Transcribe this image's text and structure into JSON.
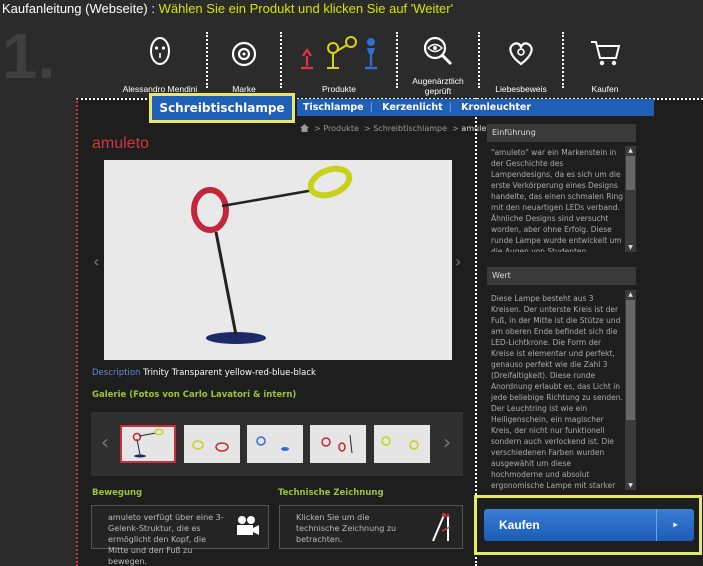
{
  "instruction": {
    "prefix": "Kaufanleitung (Webseite) : ",
    "highlight": "Wählen Sie ein Produkt und klicken Sie auf 'Weiter'"
  },
  "step_number": "1.",
  "top_nav": [
    {
      "label": "Alessandro Mendini",
      "icon": "face-mask-icon"
    },
    {
      "label": "Marke",
      "icon": "eye-target-icon"
    },
    {
      "label": "Produkte",
      "icon": "lamps-icon"
    },
    {
      "label": "Augenärztlich geprüft",
      "icon": "magnifier-eye-icon"
    },
    {
      "label": "Liebesbeweis",
      "icon": "heart-icon"
    },
    {
      "label": "Kaufen",
      "icon": "cart-icon"
    }
  ],
  "sub_nav": {
    "active": "Schreibtischlampe",
    "items": [
      "Tischlampe",
      "Kerzenlicht",
      "Kronleuchter"
    ]
  },
  "breadcrumb": {
    "items": [
      "Produkte",
      "Schreibtischlampe"
    ],
    "current": "amuleto"
  },
  "product": {
    "title": "amuleto",
    "description_key": "Description",
    "description_value": "Trinity Transparent yellow-red-blue-black"
  },
  "gallery": {
    "title": "Galerie (Fotos von Carlo Lavatori & intern)",
    "thumb_count": 5
  },
  "movement": {
    "title": "Bewegung",
    "text": "amuleto verfügt über eine 3-Gelenk-Struktur, die es ermöglicht den Kopf, die Mitte und den Fuß zu bewegen."
  },
  "technical": {
    "title": "Technische Zeichnung",
    "text": "Klicken Sie um die technische Zeichnung zu betrachten."
  },
  "intro": {
    "title": "Einführung",
    "text": "\"amuleto\" war ein Markenstein in der Geschichte des Lampendesigns, da es sich um die erste Verkörperung eines Designs handelte, das einen schmalen Ring mit den neuartigen LEDs verband. Ähnliche Designs sind versucht worden, aber ohne Erfolg. Diese runde Lampe wurde entwickelt um die Augen von Studenten, Designern und Architekten zu"
  },
  "value": {
    "title": "Wert",
    "text": "Diese Lampe besteht aus 3 Kreisen. Der unterste Kreis ist der Fuß, in der Mitte ist die Stütze und am oberen Ende befindet sich die LED-Lichtkrone. Die Form der Kreise ist elementar und perfekt, genauso perfekt wie die Zahl 3 (Dreifaltigkeit). Diese runde Anordnung erlaubt es, das Licht in jede beliebige Richtung zu senden. Der Leuchtring ist wie ein Heiligenschein, ein magischer Kreis, der nicht nur funktionell sondern auch verlockend ist. Die verschiedenen Farben wurden ausgewählt um diese hochmoderne und absolut ergonomische Lampe mit starker Ausdruckskraft zu versehen, mit dem Ziel Vorstellungskraft, Technologie und optische Präzision in"
  },
  "buy_button": {
    "label": "Kaufen",
    "arrow": "▸"
  },
  "colors": {
    "accent_blue": "#1f5fb5",
    "highlight_yellow": "#e5e86b",
    "title_red": "#d1363f",
    "section_green": "#9bc43a"
  }
}
